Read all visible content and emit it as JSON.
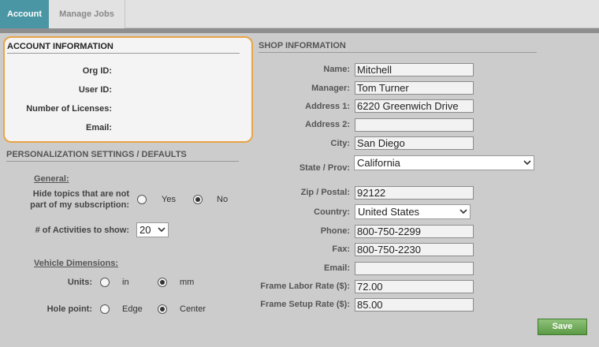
{
  "tabs": [
    {
      "label": "Account",
      "active": true
    },
    {
      "label": "Manage Jobs",
      "active": false
    }
  ],
  "account_info": {
    "title": "ACCOUNT INFORMATION",
    "fields": [
      {
        "label": "Org ID:",
        "value": ""
      },
      {
        "label": "User ID:",
        "value": ""
      },
      {
        "label": "Number of Licenses:",
        "value": ""
      },
      {
        "label": "Email:",
        "value": ""
      }
    ]
  },
  "personalization": {
    "title": "PERSONALIZATION SETTINGS / DEFAULTS",
    "general_heading": "General:",
    "hide_topics_label_line1": "Hide topics that are not",
    "hide_topics_label_line2": "part of my subscription:",
    "hide_topics_options": [
      "Yes",
      "No"
    ],
    "hide_topics_selected": "No",
    "activities_label": "# of Activities to show:",
    "activities_value": "20",
    "vehicle_heading": "Vehicle Dimensions:",
    "units_label": "Units:",
    "units_options": [
      "in",
      "mm"
    ],
    "units_selected": "mm",
    "hole_point_label": "Hole point:",
    "hole_point_options": [
      "Edge",
      "Center"
    ],
    "hole_point_selected": "Center"
  },
  "shop_info": {
    "title": "SHOP INFORMATION",
    "name_label": "Name:",
    "name_value": "Mitchell",
    "manager_label": "Manager:",
    "manager_value": "Tom Turner",
    "address1_label": "Address 1:",
    "address1_value": "6220 Greenwich Drive",
    "address2_label": "Address 2:",
    "address2_value": "",
    "city_label": "City:",
    "city_value": "San Diego",
    "state_label": "State / Prov:",
    "state_value": "California",
    "zip_label": "Zip / Postal:",
    "zip_value": "92122",
    "country_label": "Country:",
    "country_value": "United States",
    "phone_label": "Phone:",
    "phone_value": "800-750-2299",
    "fax_label": "Fax:",
    "fax_value": "800-750-2230",
    "email_label": "Email:",
    "email_value": "",
    "frame_labor_label": "Frame Labor Rate ($):",
    "frame_labor_value": "72.00",
    "frame_setup_label": "Frame Setup Rate ($):",
    "frame_setup_value": "85.00"
  },
  "save_label": "Save",
  "colors": {
    "tab_active": "#4b96a4",
    "account_border": "#e8a445",
    "save_button": "#6aa653"
  }
}
